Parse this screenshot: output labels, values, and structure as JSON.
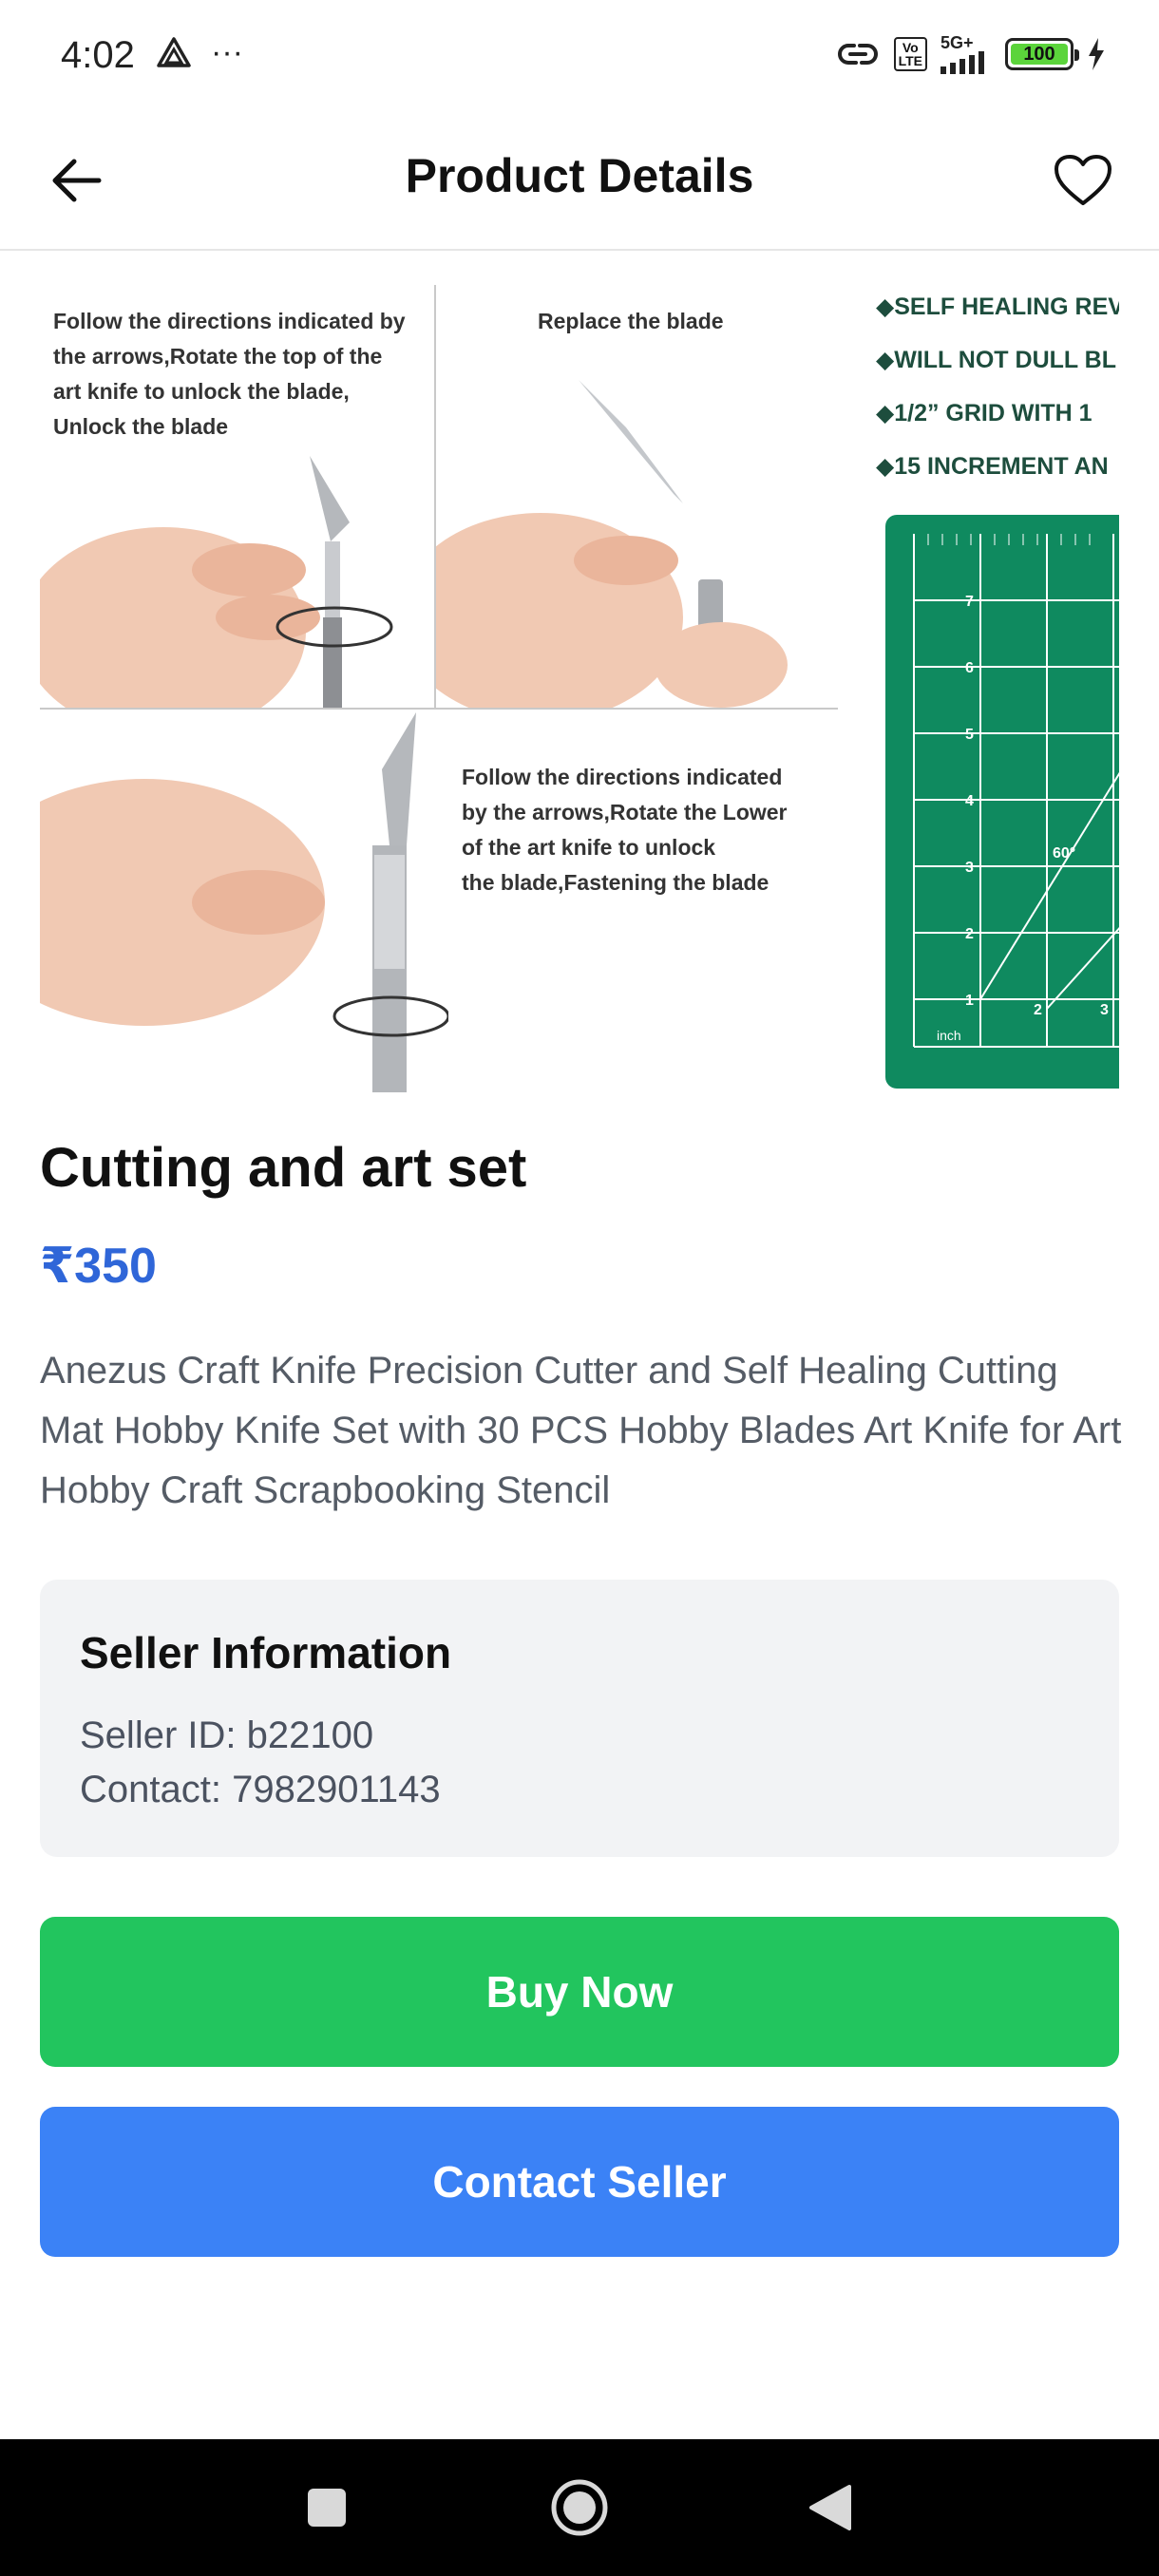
{
  "status_bar": {
    "time": "4:02",
    "more": "···",
    "network": "5G+",
    "volte_top": "Vo",
    "volte_bottom": "LTE",
    "battery": "100"
  },
  "header": {
    "title": "Product Details",
    "back_icon": "arrow-left-icon",
    "favorite_icon": "heart-outline-icon"
  },
  "gallery": {
    "panel_top_left": [
      "Follow the directions indicated by",
      "the arrows,Rotate the top of the",
      "art knife to unlock the blade,",
      "Unlock the blade"
    ],
    "panel_top_right": "Replace the blade",
    "panel_bottom_right": [
      "Follow the directions indicated",
      "by the arrows,Rotate the Lower",
      "of the art knife to unlock",
      "the blade,Fastening the blade"
    ],
    "next_features": [
      "◆SELF HEALING REV",
      "◆WILL NOT DULL BL",
      "◆1/2” GRID WITH 1",
      "◆15 INCREMENT AN"
    ],
    "mat_angle": "60°",
    "mat_unit": "inch",
    "mat_rows": [
      "7",
      "6",
      "5",
      "4",
      "3",
      "2",
      "1"
    ],
    "mat_cols": [
      "2",
      "3"
    ]
  },
  "product": {
    "title": "Cutting and art set",
    "price": "₹350",
    "description": "Anezus Craft Knife Precision Cutter and Self Healing Cutting Mat Hobby Knife Set with 30 PCS Hobby Blades Art Knife for Art Hobby Craft Scrapbooking Stencil"
  },
  "seller": {
    "heading": "Seller Information",
    "id_line": "Seller ID: b22100",
    "contact_line": "Contact: 7982901143"
  },
  "actions": {
    "buy_label": "Buy Now",
    "contact_label": "Contact Seller"
  },
  "colors": {
    "price": "#2f66d8",
    "buy": "#22c55e",
    "contact": "#3b82f6",
    "mat": "#0f8a5f"
  }
}
